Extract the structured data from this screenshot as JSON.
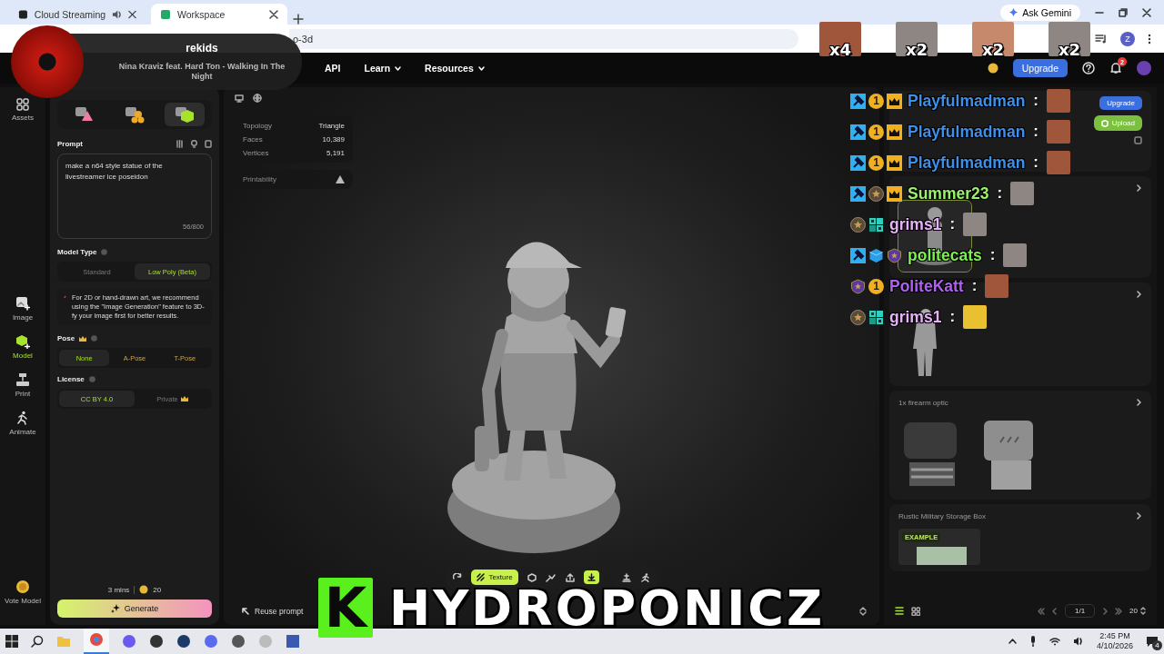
{
  "browser": {
    "tabs": [
      {
        "title": "Cloud Streaming",
        "selected": false,
        "audio": true
      },
      {
        "title": "Workspace",
        "selected": true,
        "audio": false
      }
    ],
    "address": "o-3d",
    "ask": "Ask Gemini",
    "profile": "Z"
  },
  "nav": {
    "items": [
      {
        "label": "API",
        "dropdown": false
      },
      {
        "label": "Learn",
        "dropdown": true
      },
      {
        "label": "Resources",
        "dropdown": true
      }
    ],
    "upgrade": "Upgrade",
    "notifications": "2"
  },
  "rail": {
    "items": [
      {
        "kind": "assets",
        "label": "Assets",
        "selected": false
      },
      {
        "kind": "image",
        "label": "Image",
        "selected": false
      },
      {
        "kind": "model",
        "label": "Model",
        "selected": true
      },
      {
        "kind": "print",
        "label": "Print",
        "selected": false
      },
      {
        "kind": "animate",
        "label": "Animate",
        "selected": false
      }
    ],
    "vote": "Vote Model"
  },
  "generator": {
    "modes": [
      {
        "kind": "image",
        "selected": false
      },
      {
        "kind": "multi",
        "selected": false
      },
      {
        "kind": "text",
        "selected": true
      }
    ],
    "prompt_label": "Prompt",
    "prompt": "make a n64 style statue of the livestreamer ice poseidon",
    "counter": "56/800",
    "model_type": {
      "label": "Model Type",
      "options": [
        {
          "label": "Standard",
          "selected": false
        },
        {
          "label": "Low Poly (Beta)",
          "selected": true
        }
      ]
    },
    "note": "For 2D or hand-drawn art, we recommend using the \"Image Generation\" feature to 3D-fy your image first for better results.",
    "pose": {
      "label": "Pose",
      "premium": true,
      "options": [
        {
          "label": "None",
          "selected": true
        },
        {
          "label": "A-Pose",
          "selected": false
        },
        {
          "label": "T-Pose",
          "selected": false
        }
      ]
    },
    "license": {
      "label": "License",
      "options": [
        {
          "label": "CC BY 4.0",
          "selected": true,
          "premium": false
        },
        {
          "label": "Private",
          "selected": false,
          "premium": true
        }
      ]
    },
    "time": "3 mins",
    "cost": "20",
    "generate": "Generate"
  },
  "viewport": {
    "stats": [
      {
        "label": "Topology",
        "value": "Triangle"
      },
      {
        "label": "Faces",
        "value": "10,389"
      },
      {
        "label": "Vertices",
        "value": "5,191"
      }
    ],
    "printability": "Printability",
    "texture": {
      "label": "Texture",
      "selected": true
    },
    "reuse": "Reuse prompt"
  },
  "assets": {
    "upgrade": "Upgrade",
    "upload": "Upload",
    "cards": [
      {
        "images": [
          {
            "kind": "statue",
            "selected": true
          }
        ]
      },
      {
        "images": [
          {
            "kind": "figure",
            "selected": false
          }
        ]
      },
      {
        "title": "1x firearm optic",
        "images": [
          {
            "kind": "optic",
            "selected": false
          },
          {
            "kind": "mesh",
            "selected": false
          }
        ]
      },
      {
        "title": "Rustic Military Storage Box",
        "images": [
          {
            "kind": "crate",
            "selected": false,
            "badge": "EXAMPLE"
          }
        ]
      }
    ],
    "page": "1/1",
    "per_page": "20"
  },
  "chat": [
    {
      "name": "Playfulmadman",
      "color": "#3d8fe8",
      "separator": ":",
      "emote": {
        "kind": "face"
      },
      "badges": [
        {
          "kind": "mod"
        },
        {
          "kind": "sub",
          "text": "1"
        },
        {
          "kind": "crown"
        }
      ]
    },
    {
      "name": "Playfulmadman",
      "color": "#3d8fe8",
      "separator": ":",
      "emote": {
        "kind": "face"
      },
      "badges": [
        {
          "kind": "mod"
        },
        {
          "kind": "sub",
          "text": "1"
        },
        {
          "kind": "crown"
        }
      ]
    },
    {
      "name": "Playfulmadman",
      "color": "#3d8fe8",
      "separator": ":",
      "emote": {
        "kind": "face"
      },
      "badges": [
        {
          "kind": "mod"
        },
        {
          "kind": "sub",
          "text": "1"
        },
        {
          "kind": "crown"
        }
      ]
    },
    {
      "name": "Summer23",
      "color": "#9af26a",
      "separator": ":",
      "emote": {
        "kind": "cat"
      },
      "badges": [
        {
          "kind": "mod"
        },
        {
          "kind": "star"
        },
        {
          "kind": "crown"
        }
      ]
    },
    {
      "name": "grims1",
      "color": "#e8b0f8",
      "separator": ":",
      "emote": {
        "kind": "cat"
      },
      "badges": [
        {
          "kind": "star"
        },
        {
          "kind": "og"
        }
      ]
    },
    {
      "name": "politecats",
      "color": "#7cf04c",
      "separator": ":",
      "emote": {
        "kind": "cat"
      },
      "badges": [
        {
          "kind": "mod"
        },
        {
          "kind": "cube"
        },
        {
          "kind": "shield"
        }
      ]
    },
    {
      "name": "PoliteKatt",
      "color": "#b060f0",
      "separator": ":",
      "emote": {
        "kind": "face"
      },
      "badges": [
        {
          "kind": "shield"
        },
        {
          "kind": "sub",
          "text": "1"
        }
      ]
    },
    {
      "name": "grims1",
      "color": "#e8b0f8",
      "separator": ":",
      "emote": {
        "kind": "cry"
      },
      "badges": [
        {
          "kind": "star"
        },
        {
          "kind": "og"
        }
      ]
    }
  ],
  "emote_counts": [
    {
      "emote": {
        "kind": "face"
      },
      "count": "x4"
    },
    {
      "emote": {
        "kind": "cat"
      },
      "count": "x2"
    },
    {
      "emote": {
        "kind": "laugh"
      },
      "count": "x2"
    },
    {
      "emote": {
        "kind": "cat"
      },
      "count": "x2"
    }
  ],
  "now_playing": {
    "label": "rekids",
    "track": "Nina Kraviz feat. Hard Ton - Walking In The Night"
  },
  "banner": {
    "logo": "K",
    "text": "HYDROPONICZ"
  },
  "taskbar": {
    "time": "2:45 PM",
    "date": "4/10/2026",
    "notifications": "4"
  }
}
